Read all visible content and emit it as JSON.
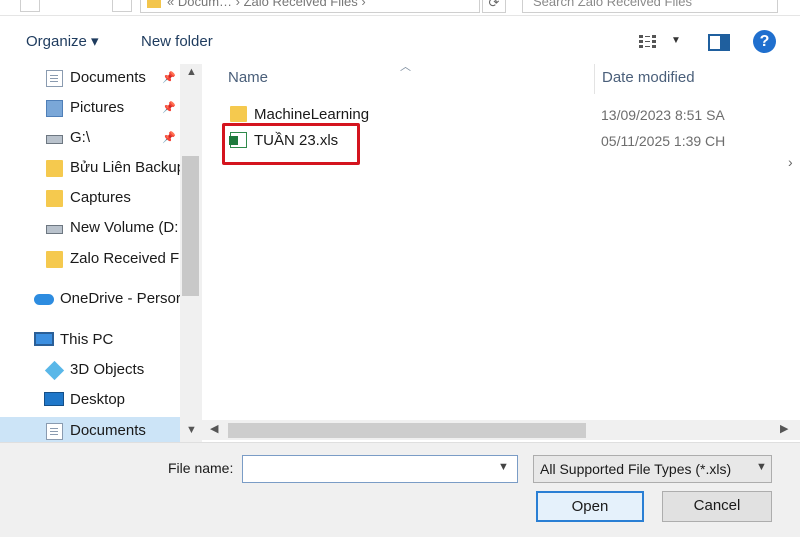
{
  "address_bar": {
    "path_text": "« Docum… › Zalo Received Files ›",
    "search_placeholder": "Search Zalo Received Files"
  },
  "toolbar": {
    "organize_label": "Organize ▾",
    "new_folder_label": "New folder"
  },
  "nav_pane": {
    "items": [
      {
        "label": "Documents",
        "icon": "document-icon",
        "pinned": true
      },
      {
        "label": "Pictures",
        "icon": "pictures-icon",
        "pinned": true
      },
      {
        "label": "G:\\",
        "icon": "drive-icon",
        "pinned": true
      },
      {
        "label": "Bửu Liên Backup",
        "icon": "folder-icon",
        "pinned": false
      },
      {
        "label": "Captures",
        "icon": "folder-icon",
        "pinned": false
      },
      {
        "label": "New Volume (D:",
        "icon": "drive-icon",
        "pinned": false
      },
      {
        "label": "Zalo Received Fi",
        "icon": "folder-icon",
        "pinned": false
      },
      {
        "label": "OneDrive - Persor",
        "icon": "onedrive-icon",
        "pinned": false
      },
      {
        "label": "This PC",
        "icon": "pc-icon",
        "pinned": false
      },
      {
        "label": "3D Objects",
        "icon": "3d-objects-icon",
        "pinned": false
      },
      {
        "label": "Desktop",
        "icon": "desktop-icon",
        "pinned": false
      },
      {
        "label": "Documents",
        "icon": "document-icon",
        "pinned": false,
        "selected": true
      }
    ]
  },
  "file_list": {
    "columns": {
      "name": "Name",
      "date_modified": "Date modified"
    },
    "rows": [
      {
        "name": "MachineLearning",
        "date": "13/09/2023 8:51 SA",
        "icon": "folder-icon"
      },
      {
        "name": "TUẦN 23.xls",
        "date": "05/11/2025 1:39 CH",
        "icon": "excel-file-icon"
      }
    ]
  },
  "footer": {
    "file_name_label": "File name:",
    "file_name_value": "",
    "file_type_selected": "All Supported File Types (*.xls)",
    "open_label": "Open",
    "cancel_label": "Cancel"
  },
  "colors": {
    "highlight": "#d4141e",
    "selected_nav": "#cce4f7",
    "help": "#1f6fce"
  }
}
